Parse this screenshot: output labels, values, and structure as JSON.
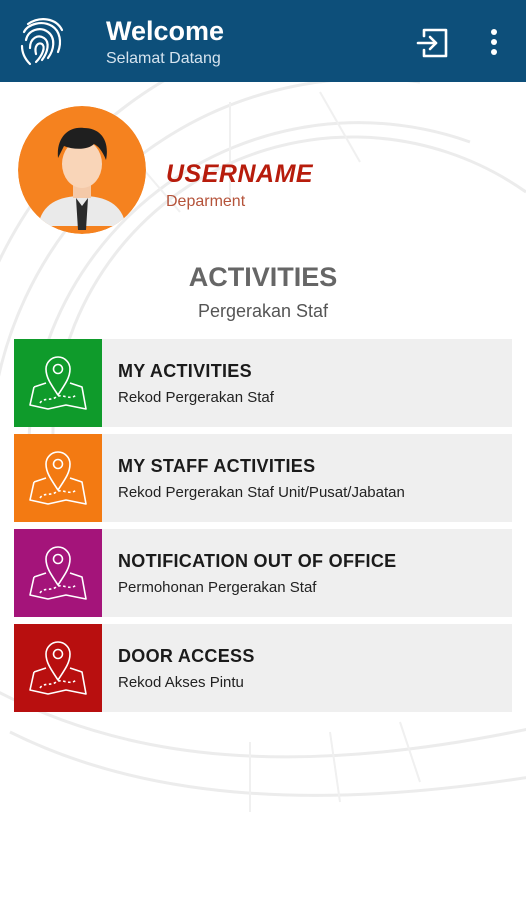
{
  "appbar": {
    "title": "Welcome",
    "subtitle": "Selamat Datang",
    "logo_icon": "fingerprint-logo-icon",
    "logout_icon": "logout-icon",
    "more_icon": "more-vert-icon",
    "color": "#0d4f7a"
  },
  "profile": {
    "username": "USERNAME",
    "department": "Deparment",
    "avatar_icon": "user-avatar-icon",
    "avatar_color": "#f5821f"
  },
  "section": {
    "title": "ACTIVITIES",
    "subtitle": "Pergerakan Staf"
  },
  "menu": [
    {
      "title": "MY ACTIVITIES",
      "subtitle": "Rekod Pergerakan Staf",
      "icon": "map-pin-icon",
      "color": "#0f9b2b"
    },
    {
      "title": "MY STAFF ACTIVITIES",
      "subtitle": "Rekod Pergerakan Staf Unit/Pusat/Jabatan",
      "icon": "map-pin-icon",
      "color": "#f37a12"
    },
    {
      "title": "NOTIFICATION OUT OF OFFICE",
      "subtitle": "Permohonan Pergerakan Staf",
      "icon": "map-pin-icon",
      "color": "#a4147a"
    },
    {
      "title": "DOOR ACCESS",
      "subtitle": "Rekod Akses Pintu",
      "icon": "map-pin-icon",
      "color": "#b80f0f"
    }
  ]
}
